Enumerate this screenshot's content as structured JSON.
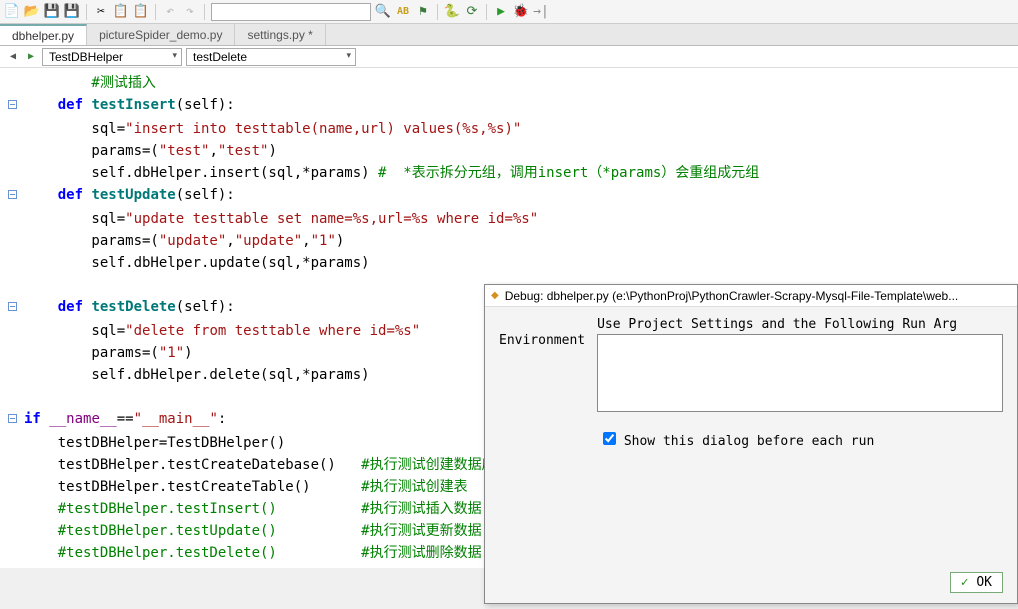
{
  "tabs": [
    {
      "label": "dbhelper.py"
    },
    {
      "label": "pictureSpider_demo.py"
    },
    {
      "label": "settings.py *"
    }
  ],
  "breadcrumb": {
    "class": "TestDBHelper",
    "method": "testDelete"
  },
  "code": {
    "l1": "        #测试插入",
    "l2a": "    def ",
    "l2b": "testInsert",
    "l2c": "(self):",
    "l3a": "        sql=",
    "l3b": "\"insert into testtable(name,url) values(%s,%s)\"",
    "l4a": "        params=(",
    "l4b": "\"test\"",
    "l4c": ",",
    "l4d": "\"test\"",
    "l4e": ")",
    "l5a": "        self.dbHelper.insert(sql,*params) ",
    "l5b": "#  *表示拆分元组，调用insert（*params）会重组成元组",
    "l6a": "    def ",
    "l6b": "testUpdate",
    "l6c": "(self):",
    "l7a": "        sql=",
    "l7b": "\"update testtable set name=%s,url=%s where id=%s\"",
    "l8a": "        params=(",
    "l8b": "\"update\"",
    "l8c": ",",
    "l8d": "\"update\"",
    "l8e": ",",
    "l8f": "\"1\"",
    "l8g": ")",
    "l9": "        self.dbHelper.update(sql,*params)",
    "l11a": "    def ",
    "l11b": "testDelete",
    "l11c": "(self):",
    "l12a": "        sql=",
    "l12b": "\"delete from testtable where id=%s\"",
    "l13a": "        params=(",
    "l13b": "\"1\"",
    "l13c": ")",
    "l14": "        self.dbHelper.delete(sql,*params)",
    "l16a": "if ",
    "l16b": "__name__",
    "l16c": "==",
    "l16d": "\"__main__\"",
    "l16e": ":",
    "l17a": "    testDBHelper=TestDBHelper()",
    "l18a": "    testDBHelper.testCreateDatebase()   ",
    "l18b": "#执行测试创建数据库",
    "l19a": "    testDBHelper.testCreateTable()      ",
    "l19b": "#执行测试创建表",
    "l20": "    #testDBHelper.testInsert()          #执行测试插入数据",
    "l21": "    #testDBHelper.testUpdate()          #执行测试更新数据",
    "l22": "    #testDBHelper.testDelete()          #执行测试删除数据"
  },
  "dialog": {
    "title": "Debug: dbhelper.py (e:\\PythonProj\\PythonCrawler-Scrapy-Mysql-File-Template\\web...",
    "envLabel": "Environment",
    "fieldTitle": "Use Project Settings and the Following Run Arg",
    "checkboxLabel": " Show this dialog before each run",
    "okLabel": "OK"
  }
}
